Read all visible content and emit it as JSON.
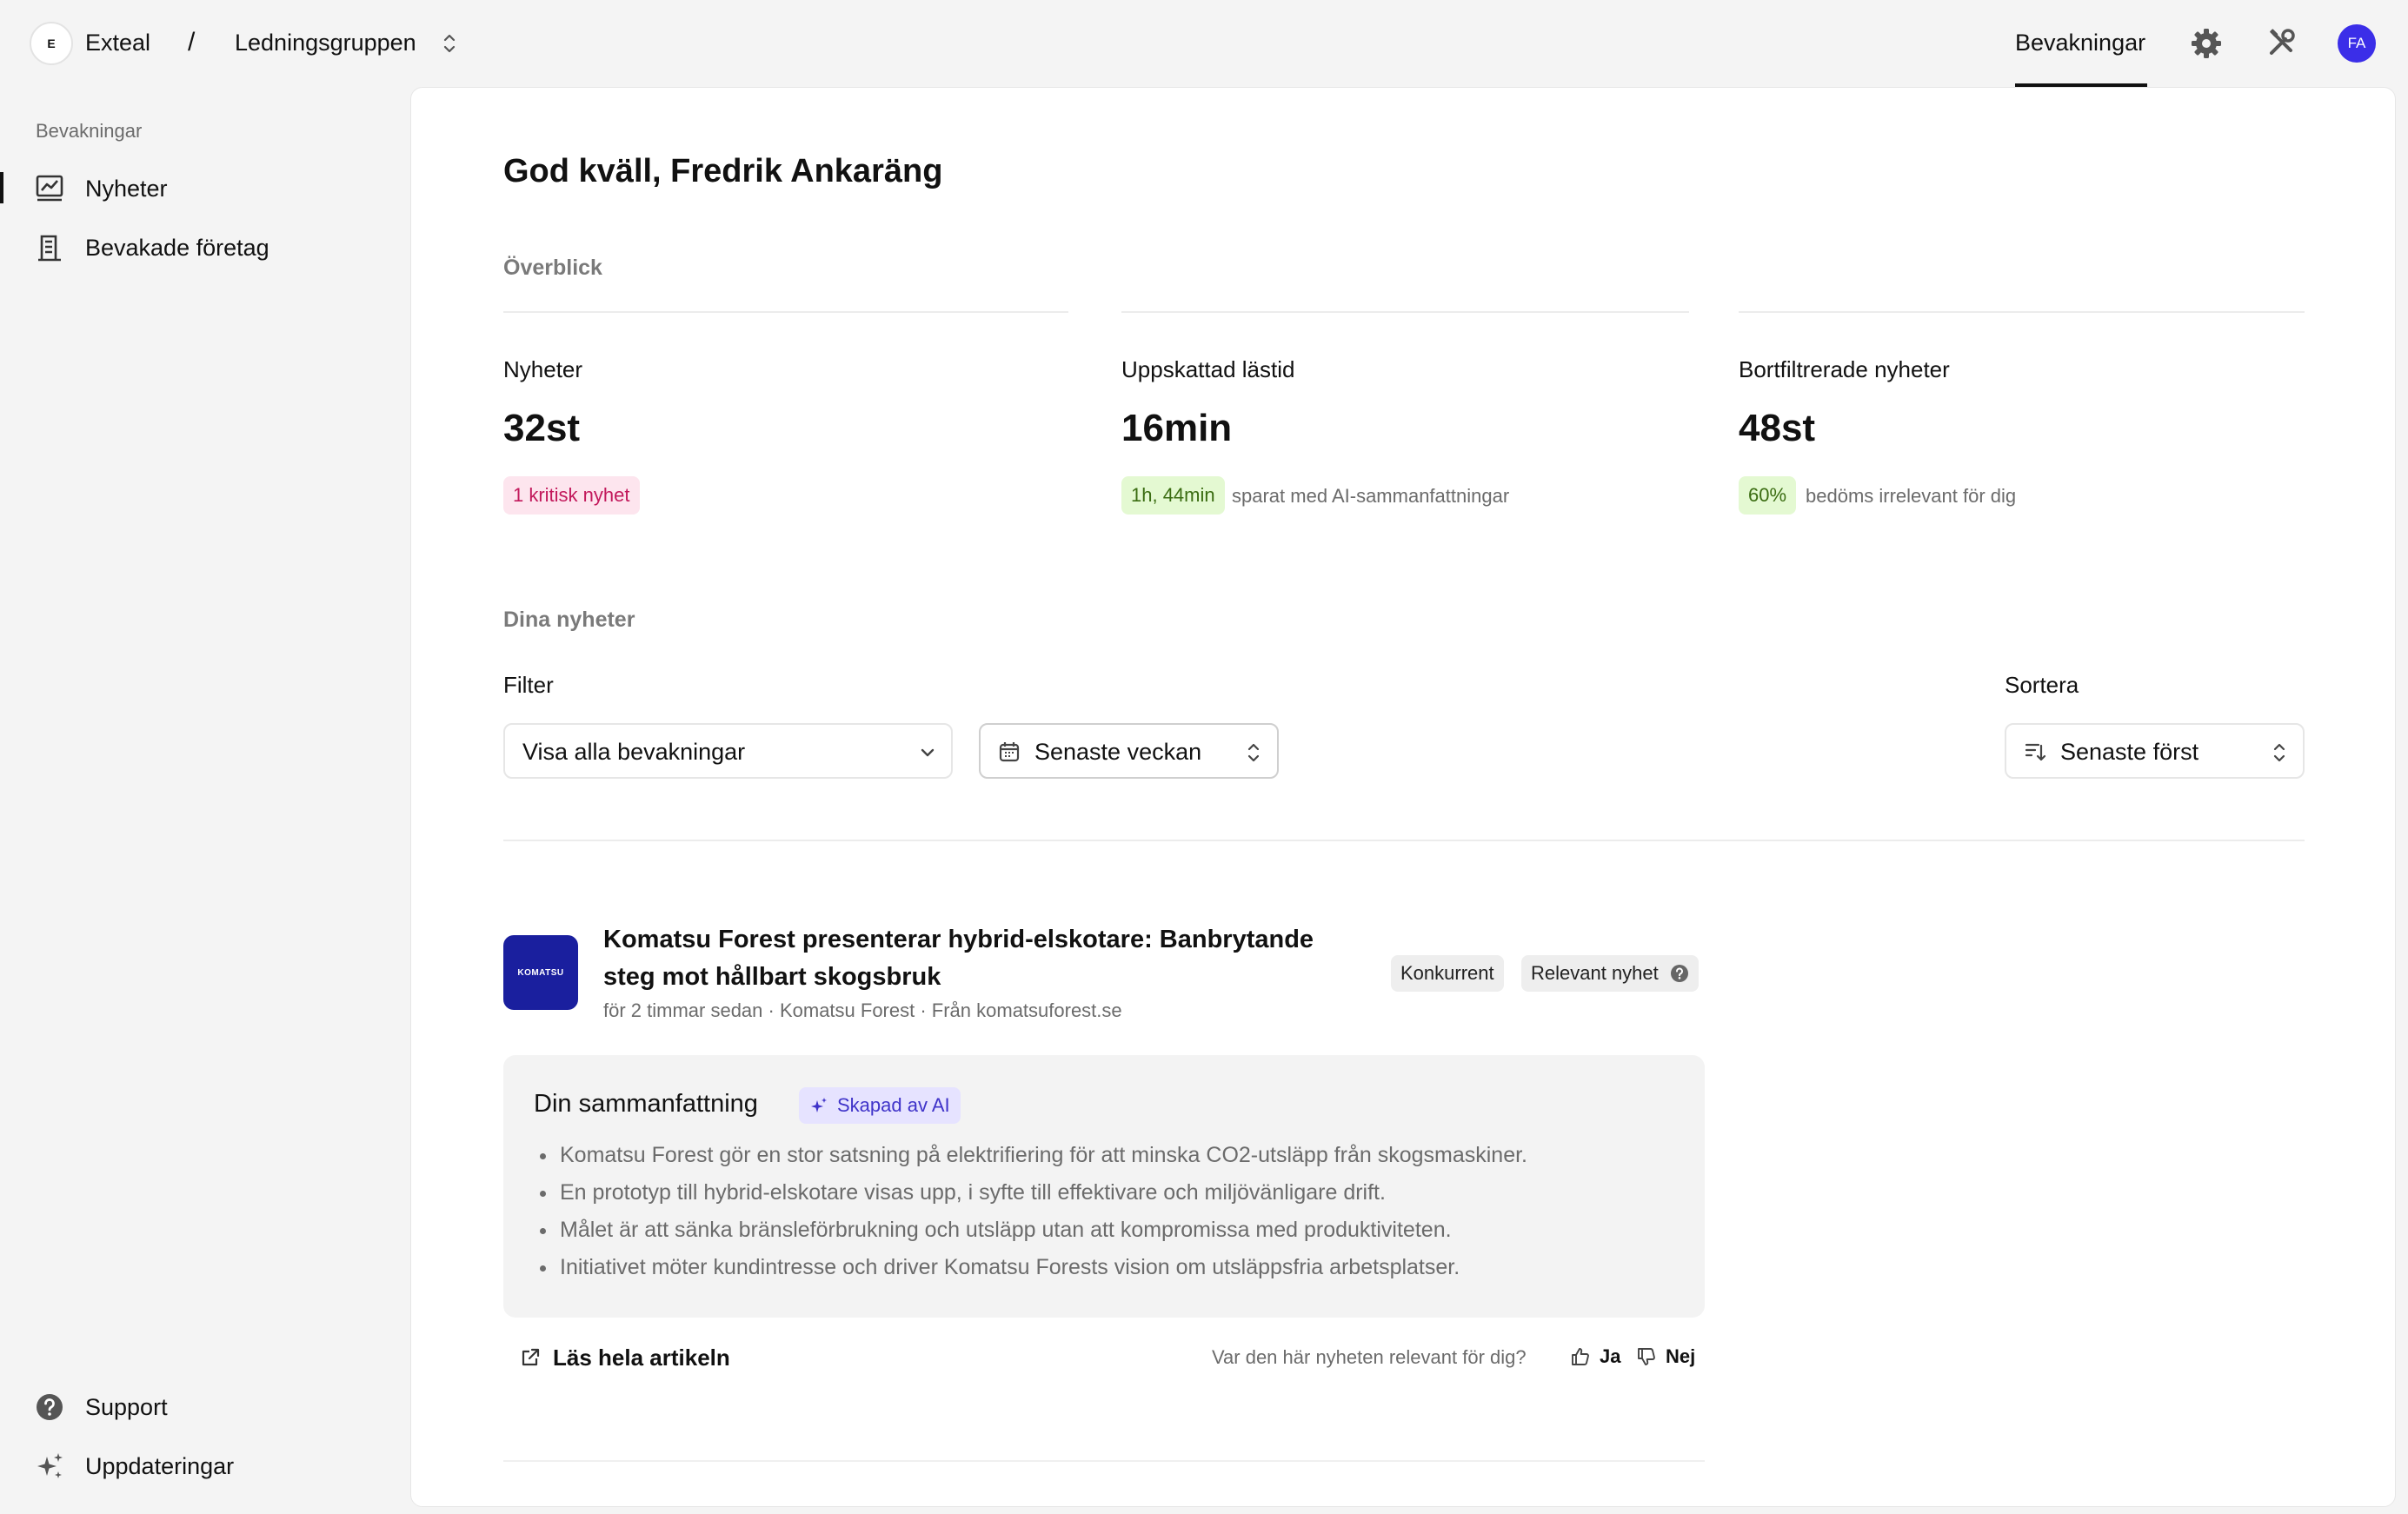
{
  "header": {
    "org_initial": "E",
    "org_name": "Exteal",
    "separator": "/",
    "group_name": "Ledningsgruppen",
    "nav_tab": "Bevakningar",
    "user_initials": "FA"
  },
  "sidebar": {
    "heading": "Bevakningar",
    "items": [
      {
        "label": "Nyheter",
        "icon": "news-icon",
        "active": true
      },
      {
        "label": "Bevakade företag",
        "icon": "building-icon",
        "active": false
      }
    ],
    "bottom_items": [
      {
        "label": "Support",
        "icon": "help-circle-icon"
      },
      {
        "label": "Uppdateringar",
        "icon": "sparkles-icon"
      }
    ]
  },
  "main": {
    "greeting": "God kväll, Fredrik Ankaräng",
    "overview_label": "Överblick",
    "stats": [
      {
        "title": "Nyheter",
        "value": "32st",
        "pill": "1 kritisk nyhet",
        "note": ""
      },
      {
        "title": "Uppskattad lästid",
        "value": "16min",
        "pill": "1h, 44min",
        "note": "sparat med AI-sammanfattningar"
      },
      {
        "title": "Bortfiltrerade nyheter",
        "value": "48st",
        "pill": "60%",
        "note": "bedöms irrelevant för dig"
      }
    ],
    "news_label": "Dina nyheter",
    "filter_label": "Filter",
    "sort_label": "Sortera",
    "filter_select": "Visa alla bevakningar",
    "period_select": "Senaste veckan",
    "sort_select": "Senaste först"
  },
  "article": {
    "logo_text": "KOMATSU",
    "title": "Komatsu Forest presenterar hybrid-elskotare: Banbrytande steg mot hållbart skogsbruk",
    "meta": "för 2 timmar sedan · Komatsu Forest · Från komatsuforest.se",
    "tags": [
      "Konkurrent",
      "Relevant nyhet"
    ],
    "summary_title": "Din sammanfattning",
    "ai_badge": "Skapad av AI",
    "bullets": [
      "Komatsu Forest gör en stor satsning på elektrifiering för att minska CO2-utsläpp från skogsmaskiner.",
      "En prototyp till hybrid-elskotare visas upp, i syfte till effektivare och miljövänligare drift.",
      "Målet är att sänka bränsleförbrukning och utsläpp utan att kompromissa med produktiviteten.",
      "Initiativet möter kundintresse och driver Komatsu Forests vision om utsläppsfria arbetsplatser."
    ],
    "read_more": "Läs hela artikeln",
    "relevance_question": "Var den här nyheten relevant för dig?",
    "yes": "Ja",
    "no": "Nej"
  },
  "colors": {
    "accent": "#3b2ee8",
    "critical_bg": "#fde5ee",
    "critical_fg": "#c2185b",
    "positive_bg": "#e4f9d2",
    "positive_fg": "#3b6d12",
    "ai_bg": "#e6e3ff",
    "ai_fg": "#3f33c9"
  }
}
